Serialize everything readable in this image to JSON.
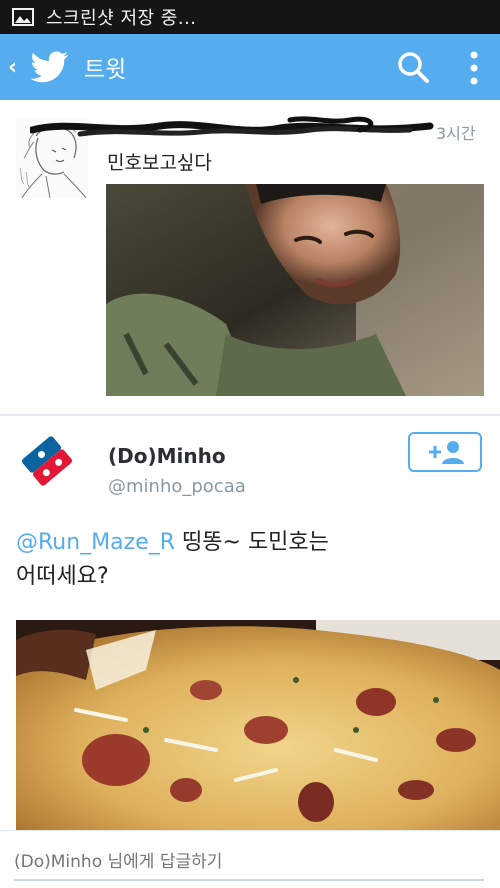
{
  "statusbar": {
    "text": "스크린샷 저장 중..."
  },
  "appbar": {
    "title": "트윗"
  },
  "tweet1": {
    "time": "3시간",
    "text": "민호보고싶다"
  },
  "tweet2": {
    "display_name": "(Do)Minho",
    "handle": "@minho_pocaa",
    "mention": "@Run_Maze_R",
    "text_line1": "띵똥~ 도민호는",
    "text_line2": "어떠세요?"
  },
  "reply": {
    "placeholder": "(Do)Minho 님에게 답글하기"
  },
  "colors": {
    "accent": "#55acee",
    "statusbar": "#151515",
    "muted": "#8899a6"
  },
  "icons": [
    "image-icon",
    "back-chevron-icon",
    "twitter-bird-icon",
    "search-icon",
    "more-vert-icon",
    "follow-user-icon"
  ]
}
